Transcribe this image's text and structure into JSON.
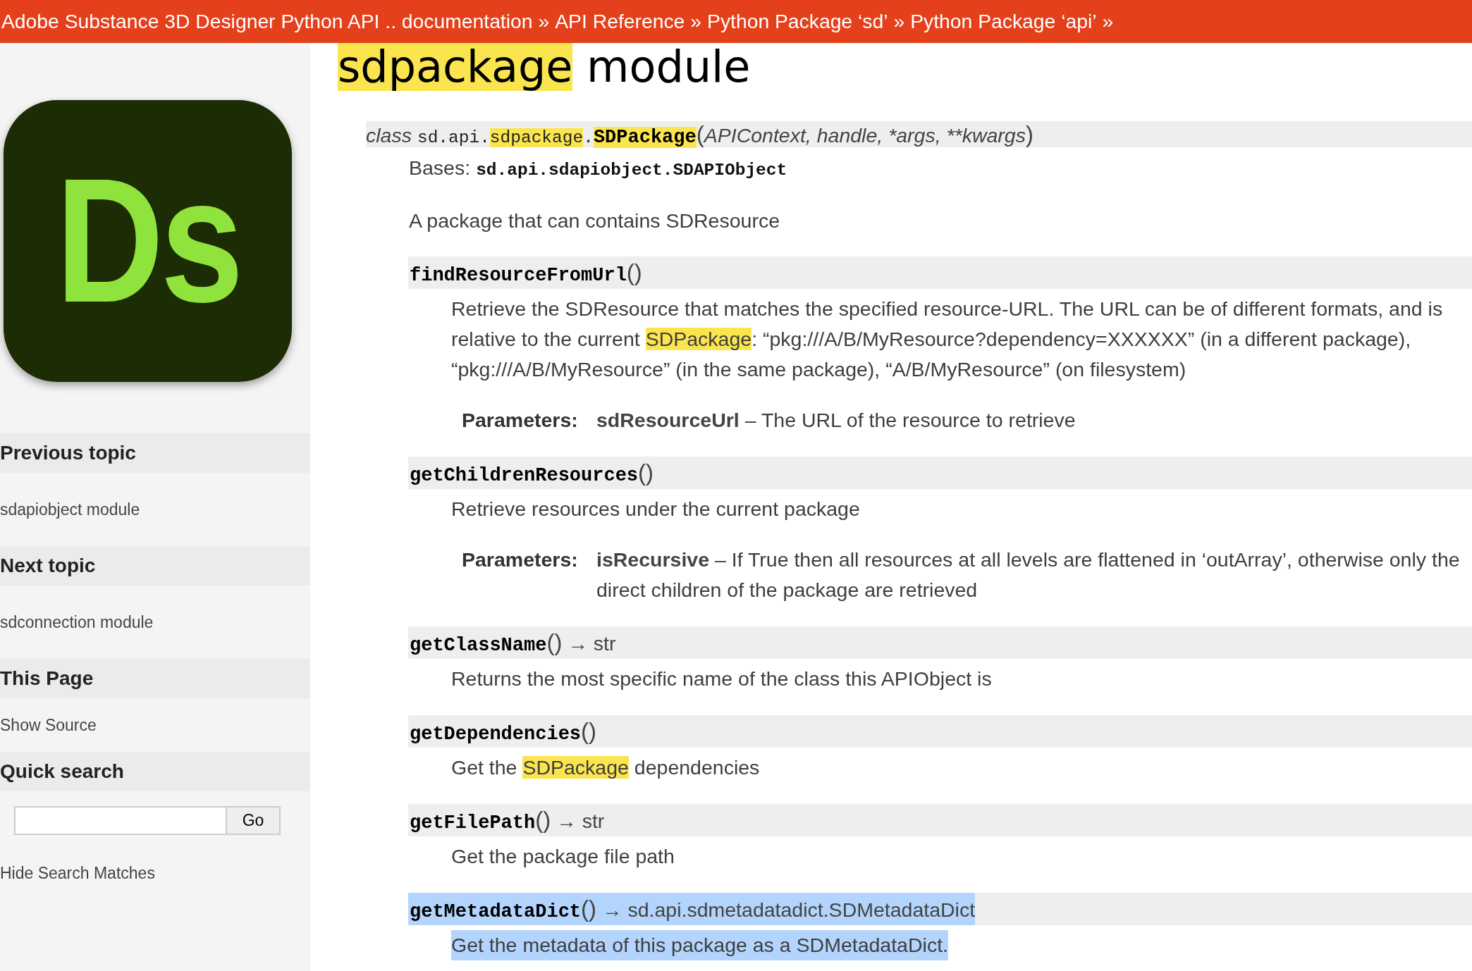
{
  "breadcrumbs": [
    {
      "label": "Adobe Substance 3D Designer Python API .. documentation",
      "separator": "»"
    },
    {
      "label": "API Reference",
      "separator": "»"
    },
    {
      "label": "Python Package ‘sd’",
      "separator": "»"
    },
    {
      "label": "Python Package ‘api’",
      "separator": "»"
    }
  ],
  "sidebar": {
    "logo": {
      "text": "Ds"
    },
    "sections": [
      {
        "kind": "links",
        "heading": "Previous topic",
        "links": [
          "sdapiobject module"
        ]
      },
      {
        "kind": "links",
        "heading": "Next topic",
        "links": [
          "sdconnection module"
        ]
      },
      {
        "kind": "links",
        "heading": "This Page",
        "links": [
          "Show Source"
        ]
      },
      {
        "kind": "search",
        "heading": "Quick search",
        "button": "Go",
        "links": [
          "Hide Search Matches"
        ]
      }
    ]
  },
  "content": {
    "title": [
      {
        "text": "sdpackage",
        "highlighted": true
      },
      {
        "text": " module",
        "highlighted": false
      }
    ],
    "class_signature": {
      "keyword": "class",
      "path": [
        {
          "text": "sd.api.",
          "highlighted": false
        },
        {
          "text": "sdpackage",
          "highlighted": true
        },
        {
          "text": ".",
          "highlighted": false
        }
      ],
      "name": {
        "text": "SDPackage",
        "highlighted": true
      },
      "open_paren": "(",
      "params": "APIContext, handle, *args, **kwargs",
      "close_paren": ")"
    },
    "bases": {
      "label": "Bases:",
      "value": "sd.api.sdapiobject.SDAPIObject"
    },
    "summary": "A package that can contains SDResource",
    "methods": [
      {
        "name": "findResourceFromUrl",
        "parens": "()",
        "selected": false,
        "description": [
          {
            "text": "Retrieve the SDResource that matches the specified resource-URL. The URL can be of different formats, and is relative to the current ",
            "highlighted": false
          },
          {
            "text": "SDPackage",
            "highlighted": true
          },
          {
            "text": ": “pkg:///A/B/MyResource?dependency=XXXXXX” (in a different package), “pkg:///A/B/MyResource” (in the same package), “A/B/MyResource” (on filesystem)",
            "highlighted": false
          }
        ],
        "parameters": {
          "label": "Parameters:",
          "text": "**sdResourceUrl** – The URL of the resource to retrieve"
        }
      },
      {
        "name": "getChildrenResources",
        "parens": "()",
        "selected": false,
        "description": [
          {
            "text": "Retrieve resources under the current package",
            "highlighted": false
          }
        ],
        "parameters": {
          "label": "Parameters:",
          "text": "**isRecursive** – If True then all resources at all levels are flattened in ‘outArray’, otherwise only the direct children of the package are retrieved"
        }
      },
      {
        "name": "getClassName",
        "parens": "()",
        "returns": "→ str",
        "selected": false,
        "description": [
          {
            "text": "Returns the most specific name of the class this APIObject is",
            "highlighted": false
          }
        ]
      },
      {
        "name": "getDependencies",
        "parens": "()",
        "selected": false,
        "description": [
          {
            "text": "Get the ",
            "highlighted": false
          },
          {
            "text": "SDPackage",
            "highlighted": true
          },
          {
            "text": " dependencies",
            "highlighted": false
          }
        ]
      },
      {
        "name": "getFilePath",
        "parens": "()",
        "returns": "→ str",
        "selected": false,
        "description": [
          {
            "text": "Get the package file path",
            "highlighted": false
          }
        ]
      },
      {
        "name": "getMetadataDict",
        "parens": "()",
        "returns": "→ sd.api.sdmetadatadict.SDMetadataDict",
        "selected": true,
        "description": [
          {
            "text": "Get the metadata of this package as a SDMetadataDict.",
            "highlighted": false
          }
        ]
      }
    ]
  }
}
